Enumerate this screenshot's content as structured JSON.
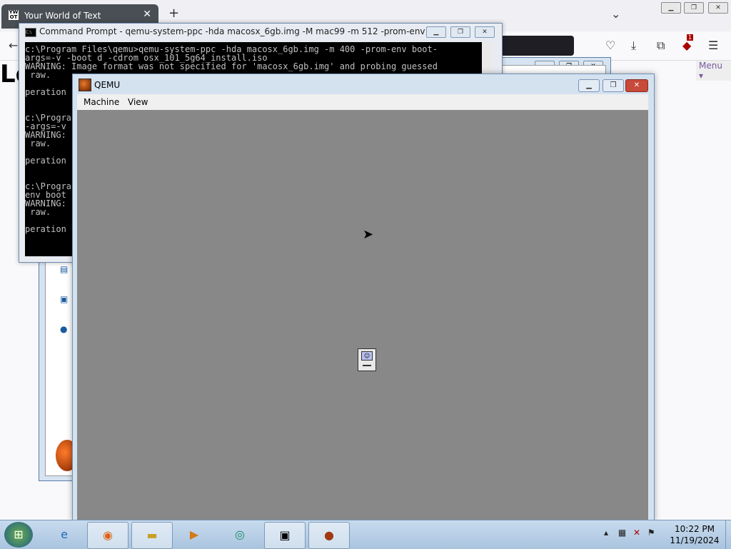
{
  "browser": {
    "tab_title": "Your World of Text",
    "tab_favicon_text": "YW OT",
    "new_tab_glyph": "+",
    "close_tab_glyph": "✕",
    "page_heading_partial": "Lo",
    "page_menu": "Menu ▾",
    "extension_badge": "1"
  },
  "cmd": {
    "title": "Command Prompt - qemu-system-ppc  -hda macosx_6gb.img -M mac99 -m 512 -prom-env boot-...",
    "lines": [
      "c:\\Program Files\\qemu>qemu-system-ppc -hda macosx_6gb.img -m 400 -prom-env boot-",
      "args=-v -boot d -cdrom osx_101_5g64_install.iso",
      "WARNING: Image format was not specified for 'macosx_6gb.img' and probing guessed",
      " raw.",
      "",
      "peration",
      "",
      "",
      "c:\\Progra",
      "-args=-v",
      "WARNING:",
      " raw.",
      "",
      "peration",
      "",
      "",
      "c:\\Progra",
      "env boot",
      "WARNING:",
      " raw.",
      "",
      "peration"
    ]
  },
  "qemu": {
    "title": "QEMU",
    "menu": [
      "Machine",
      "View"
    ]
  },
  "taskbar": {
    "time": "10:22 PM",
    "date": "11/19/2024"
  },
  "icons": {
    "start": "windows-logo",
    "ie": "internet-explorer",
    "firefox": "firefox",
    "explorer": "folder",
    "media": "media-player",
    "app5": "globe",
    "cmd": "command-prompt",
    "qemu": "qemu"
  }
}
